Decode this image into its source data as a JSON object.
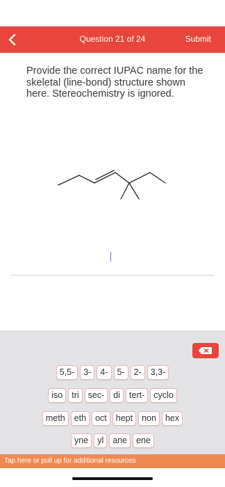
{
  "header": {
    "title": "Question 21 of 24",
    "submit_label": "Submit",
    "color": "#e8453c"
  },
  "question": {
    "prompt": "Provide the correct IUPAC name for the skeletal (line-bond) structure shown here. Stereochemistry is ignored."
  },
  "answer": {
    "value": ""
  },
  "keyboard": {
    "delete_icon": "backspace-icon",
    "rows": [
      [
        "5,5-",
        "3-",
        "4-",
        "5-",
        "2-",
        "3,3-"
      ],
      [
        "iso",
        "tri",
        "sec-",
        "di",
        "tert-",
        "cyclo"
      ],
      [
        "meth",
        "eth",
        "oct",
        "hept",
        "non",
        "hex"
      ],
      [
        "yne",
        "yl",
        "ane",
        "ene"
      ]
    ]
  },
  "footer": {
    "resources_label": "Tap here or pull up for additional resources",
    "color": "#f08a53"
  }
}
